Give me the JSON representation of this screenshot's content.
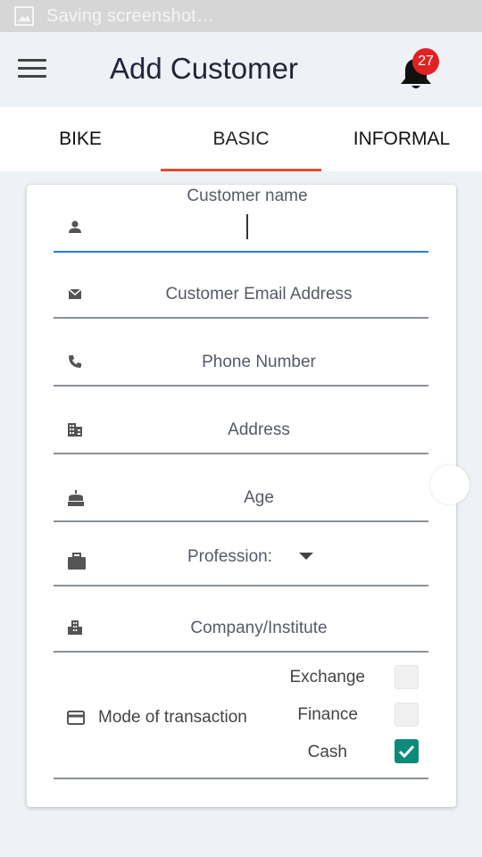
{
  "status_bar": {
    "text": "Saving screenshot…",
    "icon": "image-icon"
  },
  "app_bar": {
    "title": "Add Customer",
    "menu_icon": "hamburger-menu-icon",
    "notification_count": "27"
  },
  "tabs": [
    {
      "label": "BIKE",
      "active": false
    },
    {
      "label": "BASIC",
      "active": true
    },
    {
      "label": "INFORMAL",
      "active": false
    }
  ],
  "form": {
    "customer_name": {
      "label": "Customer name",
      "value": ""
    },
    "email": {
      "placeholder": "Customer Email Address"
    },
    "phone": {
      "placeholder": "Phone Number"
    },
    "address": {
      "placeholder": "Address"
    },
    "age": {
      "placeholder": "Age"
    },
    "profession": {
      "placeholder": "Profession:"
    },
    "company": {
      "placeholder": "Company/Institute"
    },
    "mode_of_transaction": {
      "label": "Mode of transaction",
      "options": [
        {
          "label": "Exchange",
          "checked": false
        },
        {
          "label": "Finance",
          "checked": false
        },
        {
          "label": "Cash",
          "checked": true
        }
      ]
    }
  },
  "colors": {
    "accent_tab": "#e34b2e",
    "focus_line": "#2a7de1",
    "checkbox_checked": "#0e8a7a",
    "badge": "#e12222"
  }
}
